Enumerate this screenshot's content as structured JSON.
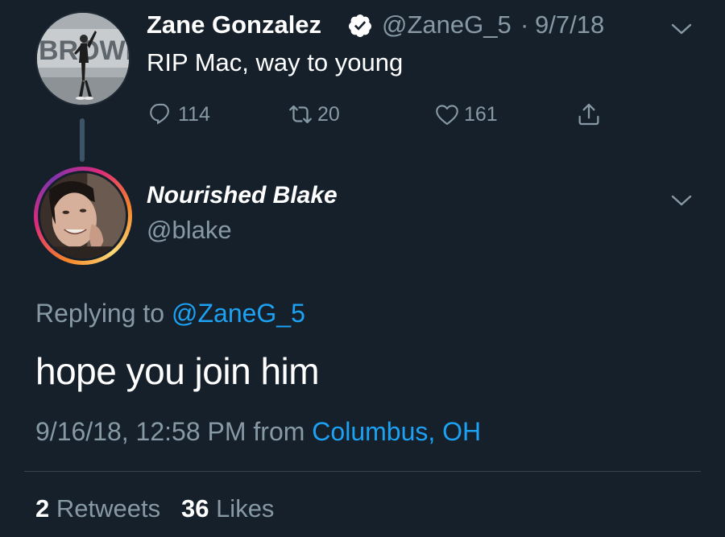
{
  "parent_tweet": {
    "author_name": "Zane Gonzalez",
    "verified": true,
    "handle": "@ZaneG_5",
    "separator": "·",
    "date": "9/7/18",
    "text": "RIP Mac, way to young",
    "avatar_sign_text": "BROWNS",
    "actions": {
      "reply_count": "114",
      "retweet_count": "20",
      "like_count": "161"
    },
    "icons": [
      "reply-icon",
      "retweet-icon",
      "like-icon",
      "share-icon",
      "verified-badge-icon",
      "chevron-down-icon"
    ]
  },
  "reply_tweet": {
    "author_name": "Nourished Blake",
    "handle": "@blake",
    "replying_prefix": "Replying to",
    "replying_to": "@ZaneG_5",
    "text": "hope you join him",
    "timestamp": "9/16/18, 12:58 PM",
    "from_label": "from",
    "location": "Columbus, OH",
    "stats": {
      "retweets_count": "2",
      "retweets_label": "Retweets",
      "likes_count": "36",
      "likes_label": "Likes"
    }
  },
  "colors": {
    "background": "#15202b",
    "text_primary": "#ffffff",
    "text_secondary": "#8899a6",
    "accent": "#1da1f2",
    "thread_line": "#3d5466",
    "divider": "#38444d"
  }
}
